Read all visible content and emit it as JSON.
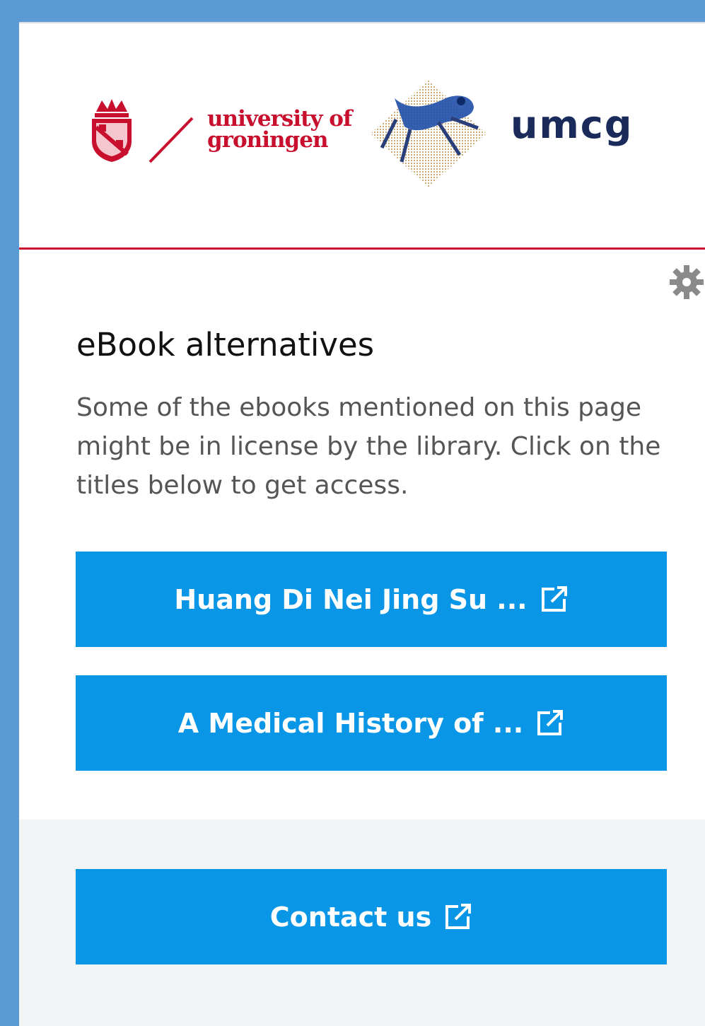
{
  "header": {
    "university_line1": "university of",
    "university_line2": "groningen",
    "umcg": "umcg"
  },
  "main": {
    "title": "eBook alternatives",
    "description": "Some of the ebooks mentioned on this page might be in license by the library. Click on the titles below to get access.",
    "links": [
      {
        "label": "Huang Di Nei Jing Su ..."
      },
      {
        "label": "A Medical History of ..."
      }
    ]
  },
  "footer": {
    "contact_label": "Contact us"
  },
  "colors": {
    "button": "#0a96e6",
    "brand_red": "#c8102e",
    "umcg_navy": "#1a2a5a",
    "frame_blue": "#5b9bd5"
  },
  "icons": {
    "settings": "gear-icon",
    "external": "external-link-icon"
  }
}
